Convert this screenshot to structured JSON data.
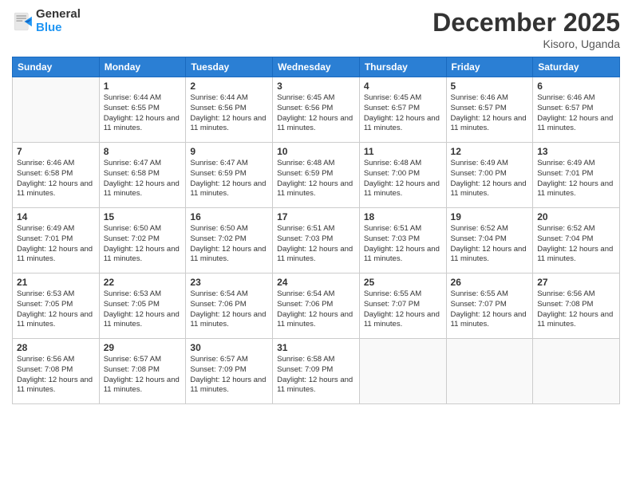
{
  "header": {
    "logo_general": "General",
    "logo_blue": "Blue",
    "title": "December 2025",
    "subtitle": "Kisoro, Uganda"
  },
  "days_of_week": [
    "Sunday",
    "Monday",
    "Tuesday",
    "Wednesday",
    "Thursday",
    "Friday",
    "Saturday"
  ],
  "weeks": [
    [
      {
        "day": "",
        "info": ""
      },
      {
        "day": "1",
        "info": "Sunrise: 6:44 AM\nSunset: 6:55 PM\nDaylight: 12 hours\nand 11 minutes."
      },
      {
        "day": "2",
        "info": "Sunrise: 6:44 AM\nSunset: 6:56 PM\nDaylight: 12 hours\nand 11 minutes."
      },
      {
        "day": "3",
        "info": "Sunrise: 6:45 AM\nSunset: 6:56 PM\nDaylight: 12 hours\nand 11 minutes."
      },
      {
        "day": "4",
        "info": "Sunrise: 6:45 AM\nSunset: 6:57 PM\nDaylight: 12 hours\nand 11 minutes."
      },
      {
        "day": "5",
        "info": "Sunrise: 6:46 AM\nSunset: 6:57 PM\nDaylight: 12 hours\nand 11 minutes."
      },
      {
        "day": "6",
        "info": "Sunrise: 6:46 AM\nSunset: 6:57 PM\nDaylight: 12 hours\nand 11 minutes."
      }
    ],
    [
      {
        "day": "7",
        "info": "Sunrise: 6:46 AM\nSunset: 6:58 PM\nDaylight: 12 hours\nand 11 minutes."
      },
      {
        "day": "8",
        "info": "Sunrise: 6:47 AM\nSunset: 6:58 PM\nDaylight: 12 hours\nand 11 minutes."
      },
      {
        "day": "9",
        "info": "Sunrise: 6:47 AM\nSunset: 6:59 PM\nDaylight: 12 hours\nand 11 minutes."
      },
      {
        "day": "10",
        "info": "Sunrise: 6:48 AM\nSunset: 6:59 PM\nDaylight: 12 hours\nand 11 minutes."
      },
      {
        "day": "11",
        "info": "Sunrise: 6:48 AM\nSunset: 7:00 PM\nDaylight: 12 hours\nand 11 minutes."
      },
      {
        "day": "12",
        "info": "Sunrise: 6:49 AM\nSunset: 7:00 PM\nDaylight: 12 hours\nand 11 minutes."
      },
      {
        "day": "13",
        "info": "Sunrise: 6:49 AM\nSunset: 7:01 PM\nDaylight: 12 hours\nand 11 minutes."
      }
    ],
    [
      {
        "day": "14",
        "info": "Sunrise: 6:49 AM\nSunset: 7:01 PM\nDaylight: 12 hours\nand 11 minutes."
      },
      {
        "day": "15",
        "info": "Sunrise: 6:50 AM\nSunset: 7:02 PM\nDaylight: 12 hours\nand 11 minutes."
      },
      {
        "day": "16",
        "info": "Sunrise: 6:50 AM\nSunset: 7:02 PM\nDaylight: 12 hours\nand 11 minutes."
      },
      {
        "day": "17",
        "info": "Sunrise: 6:51 AM\nSunset: 7:03 PM\nDaylight: 12 hours\nand 11 minutes."
      },
      {
        "day": "18",
        "info": "Sunrise: 6:51 AM\nSunset: 7:03 PM\nDaylight: 12 hours\nand 11 minutes."
      },
      {
        "day": "19",
        "info": "Sunrise: 6:52 AM\nSunset: 7:04 PM\nDaylight: 12 hours\nand 11 minutes."
      },
      {
        "day": "20",
        "info": "Sunrise: 6:52 AM\nSunset: 7:04 PM\nDaylight: 12 hours\nand 11 minutes."
      }
    ],
    [
      {
        "day": "21",
        "info": "Sunrise: 6:53 AM\nSunset: 7:05 PM\nDaylight: 12 hours\nand 11 minutes."
      },
      {
        "day": "22",
        "info": "Sunrise: 6:53 AM\nSunset: 7:05 PM\nDaylight: 12 hours\nand 11 minutes."
      },
      {
        "day": "23",
        "info": "Sunrise: 6:54 AM\nSunset: 7:06 PM\nDaylight: 12 hours\nand 11 minutes."
      },
      {
        "day": "24",
        "info": "Sunrise: 6:54 AM\nSunset: 7:06 PM\nDaylight: 12 hours\nand 11 minutes."
      },
      {
        "day": "25",
        "info": "Sunrise: 6:55 AM\nSunset: 7:07 PM\nDaylight: 12 hours\nand 11 minutes."
      },
      {
        "day": "26",
        "info": "Sunrise: 6:55 AM\nSunset: 7:07 PM\nDaylight: 12 hours\nand 11 minutes."
      },
      {
        "day": "27",
        "info": "Sunrise: 6:56 AM\nSunset: 7:08 PM\nDaylight: 12 hours\nand 11 minutes."
      }
    ],
    [
      {
        "day": "28",
        "info": "Sunrise: 6:56 AM\nSunset: 7:08 PM\nDaylight: 12 hours\nand 11 minutes."
      },
      {
        "day": "29",
        "info": "Sunrise: 6:57 AM\nSunset: 7:08 PM\nDaylight: 12 hours\nand 11 minutes."
      },
      {
        "day": "30",
        "info": "Sunrise: 6:57 AM\nSunset: 7:09 PM\nDaylight: 12 hours\nand 11 minutes."
      },
      {
        "day": "31",
        "info": "Sunrise: 6:58 AM\nSunset: 7:09 PM\nDaylight: 12 hours\nand 11 minutes."
      },
      {
        "day": "",
        "info": ""
      },
      {
        "day": "",
        "info": ""
      },
      {
        "day": "",
        "info": ""
      }
    ]
  ]
}
